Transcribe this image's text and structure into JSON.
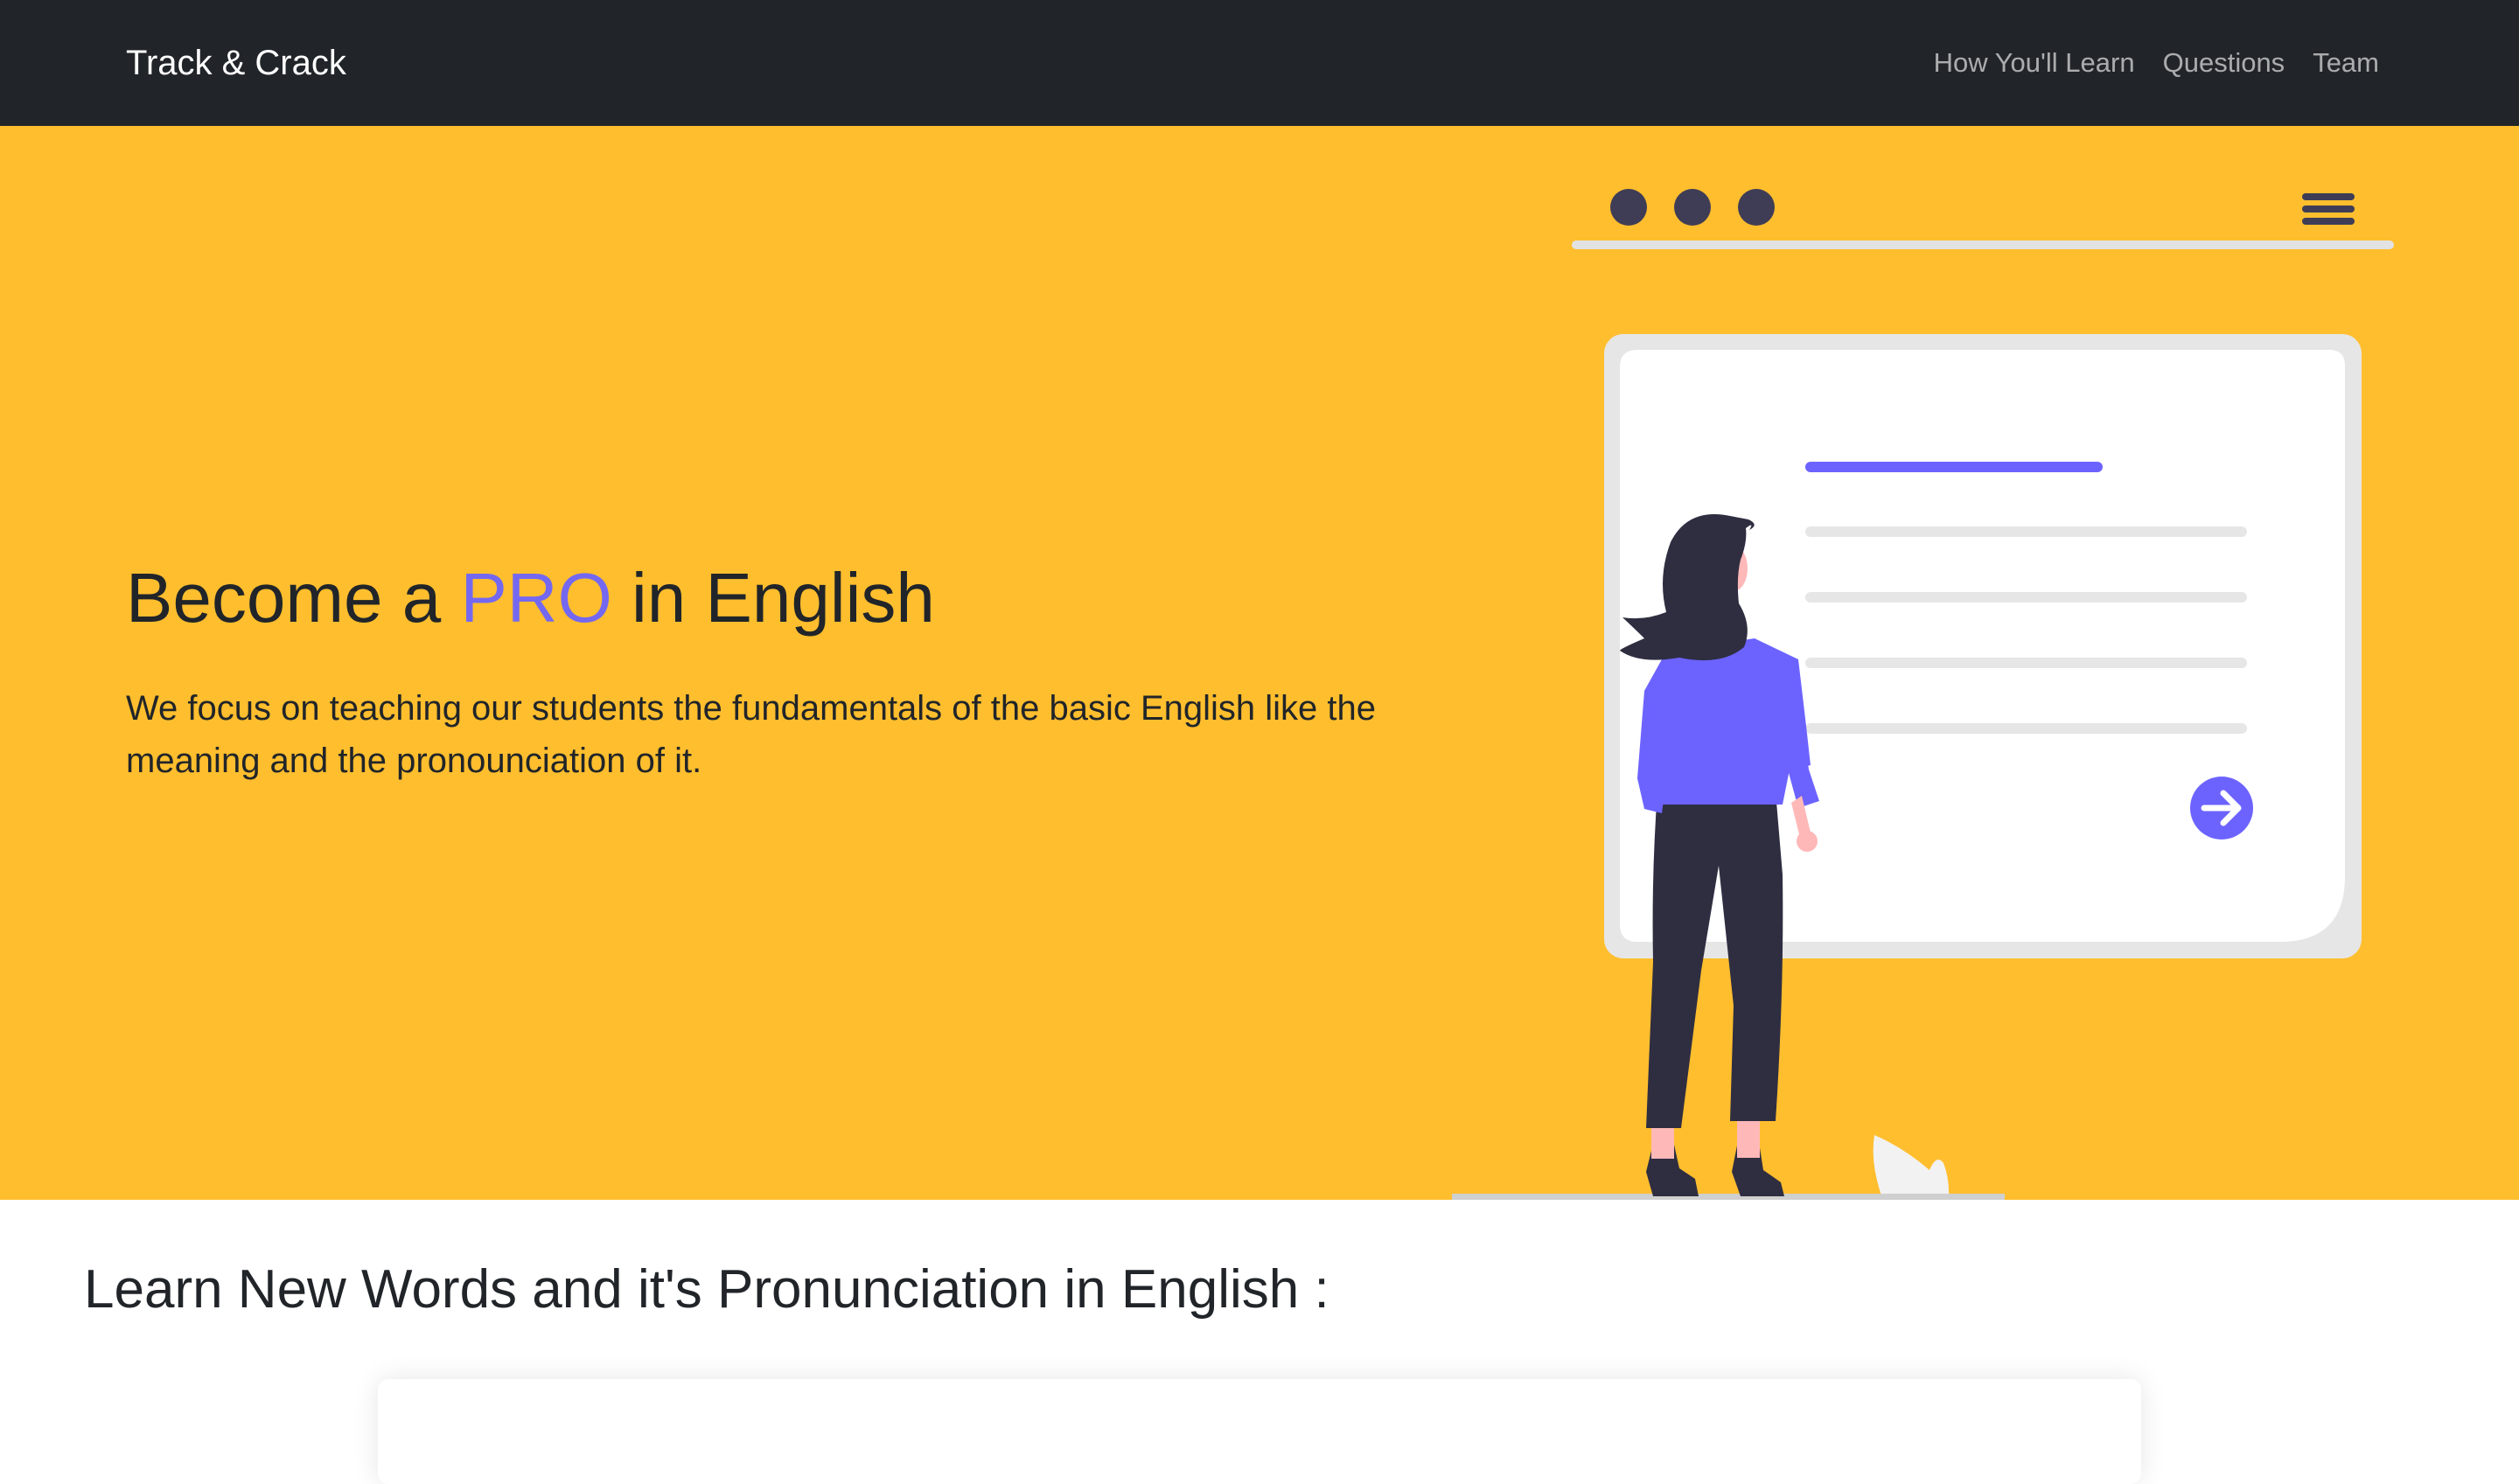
{
  "navbar": {
    "brand": "Track & Crack",
    "links": [
      {
        "label": "How You'll Learn"
      },
      {
        "label": "Questions"
      },
      {
        "label": "Team"
      }
    ]
  },
  "hero": {
    "title_prefix": "Become a",
    "title_highlight": "PRO",
    "title_suffix": "in English",
    "description": "We focus on teaching our students the fundamentals of the basic English like the meaning and the pronounciation of it."
  },
  "words_section": {
    "title": "Learn New Words and it's Pronunciation in English :"
  },
  "colors": {
    "navbar_bg": "#212529",
    "hero_bg": "#ffbe2e",
    "accent": "#7568f0",
    "text": "#212529"
  }
}
